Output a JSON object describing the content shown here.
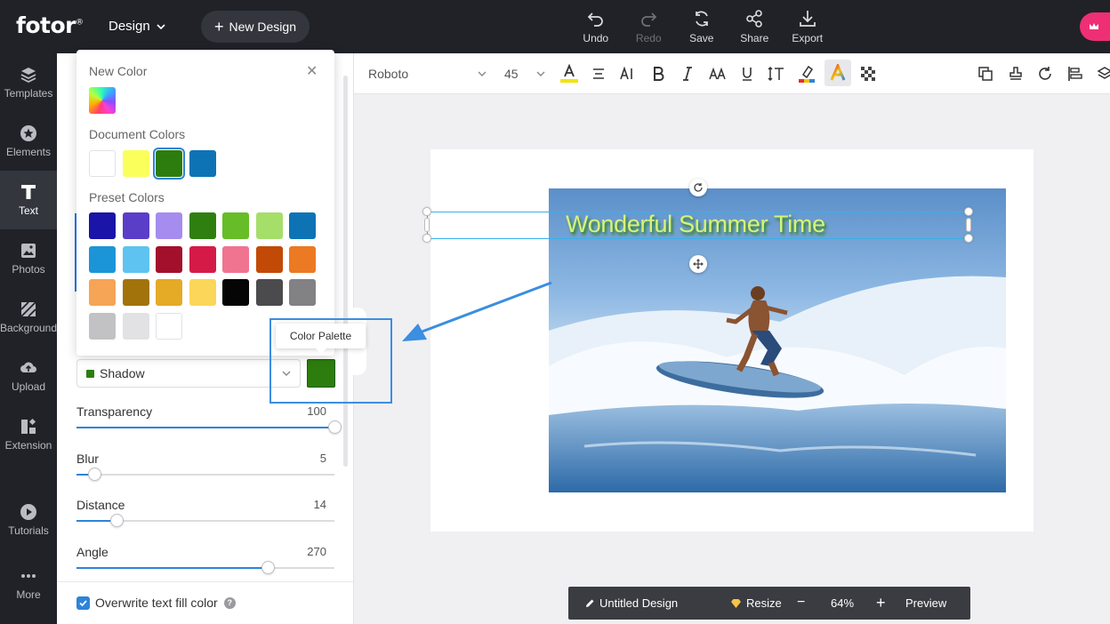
{
  "app": {
    "logo": "fotor",
    "logo_mark": "®",
    "design_menu": "Design",
    "new_design": "New Design"
  },
  "top_actions": [
    {
      "label": "Undo",
      "icon": "undo-icon",
      "enabled": true
    },
    {
      "label": "Redo",
      "icon": "redo-icon",
      "enabled": false
    },
    {
      "label": "Save",
      "icon": "save-icon",
      "enabled": true
    },
    {
      "label": "Share",
      "icon": "share-icon",
      "enabled": true
    },
    {
      "label": "Export",
      "icon": "export-icon",
      "enabled": true
    }
  ],
  "nav": [
    {
      "label": "Templates",
      "icon": "templates-icon"
    },
    {
      "label": "Elements",
      "icon": "elements-icon"
    },
    {
      "label": "Text",
      "icon": "text-icon",
      "active": true
    },
    {
      "label": "Photos",
      "icon": "photos-icon"
    },
    {
      "label": "Background",
      "icon": "background-icon"
    },
    {
      "label": "Upload",
      "icon": "upload-icon"
    },
    {
      "label": "Extension",
      "icon": "extension-icon"
    },
    {
      "label": "Tutorials",
      "icon": "tutorials-icon"
    },
    {
      "label": "More",
      "icon": "more-icon"
    }
  ],
  "color_popover": {
    "new_color_label": "New Color",
    "document_colors_label": "Document Colors",
    "preset_colors_label": "Preset Colors",
    "document_colors": [
      "#ffffff",
      "#fbff5c",
      "#2d7d0e",
      "#0e73b5"
    ],
    "selected_document_color": "#2d7d0e",
    "preset_colors": [
      "#1a14a8",
      "#5a3ec8",
      "#a58cef",
      "#2f7f10",
      "#67bd28",
      "#a6de6a",
      "#0e73b5",
      "#1b95d8",
      "#5ec3f0",
      "#a3102c",
      "#d61a47",
      "#f07490",
      "#c24a06",
      "#ec7a22",
      "#f6a455",
      "#a2730a",
      "#e5aa26",
      "#fbd659",
      "#050505",
      "#4b4b4d",
      "#828284",
      "#c2c2c4",
      "#e2e2e4",
      "#ffffff"
    ]
  },
  "tooltip": "Color Palette",
  "effect": {
    "type": "Shadow",
    "color": "#2d7d0e"
  },
  "sliders": [
    {
      "label": "Transparency",
      "value": 100,
      "fraction": 1.0
    },
    {
      "label": "Blur",
      "value": 5,
      "fraction": 0.07
    },
    {
      "label": "Distance",
      "value": 14,
      "fraction": 0.155
    },
    {
      "label": "Angle",
      "value": 270,
      "fraction": 0.74
    }
  ],
  "overwrite": {
    "label": "Overwrite text fill color",
    "checked": true
  },
  "text_toolbar": {
    "font_family": "Roboto",
    "font_size": "45",
    "text_color": "#f2e30e"
  },
  "canvas": {
    "text": "Wonderful Summer Time",
    "text_color": "#d8f27a",
    "shadow_color": "#2d7d0e"
  },
  "bottom_bar": {
    "title": "Untitled Design",
    "resize": "Resize",
    "zoom_out": "−",
    "zoom": "64%",
    "zoom_in": "+",
    "preview": "Preview"
  }
}
